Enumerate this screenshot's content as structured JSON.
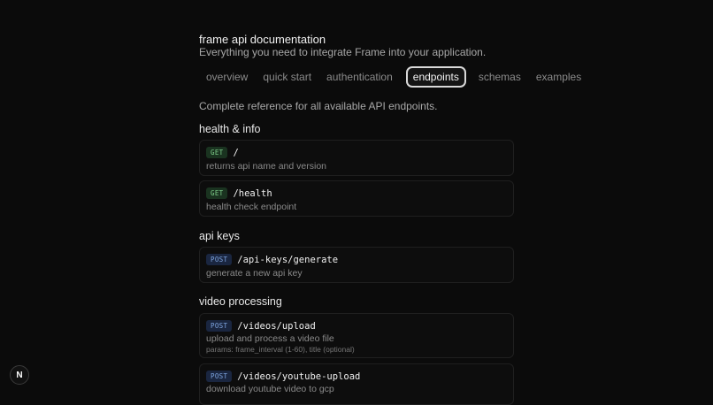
{
  "header": {
    "title": "frame api documentation",
    "subtitle": "Everything you need to integrate Frame into your application."
  },
  "tabs": [
    {
      "label": "overview",
      "active": false
    },
    {
      "label": "quick start",
      "active": false
    },
    {
      "label": "authentication",
      "active": false
    },
    {
      "label": "endpoints",
      "active": true
    },
    {
      "label": "schemas",
      "active": false
    },
    {
      "label": "examples",
      "active": false
    }
  ],
  "lead": "Complete reference for all available API endpoints.",
  "sections": [
    {
      "title": "health & info"
    },
    {
      "title": "api keys"
    },
    {
      "title": "video processing"
    }
  ],
  "endpoints": [
    {
      "method": "GET",
      "path": "/",
      "description": "returns api name and version"
    },
    {
      "method": "GET",
      "path": "/health",
      "description": "health check endpoint"
    },
    {
      "method": "POST",
      "path": "/api-keys/generate",
      "description": "generate a new api key"
    },
    {
      "method": "POST",
      "path": "/videos/upload",
      "description": "upload and process a video file",
      "params": "params: frame_interval (1-60), title (optional)"
    },
    {
      "method": "POST",
      "path": "/videos/youtube-upload",
      "description": "download youtube video to gcp"
    }
  ],
  "badge_colors": {
    "GET": "#7fce8a",
    "POST": "#7fa6e0"
  },
  "logo": {
    "glyph": "N",
    "icon": "nextjs-logo-icon"
  }
}
